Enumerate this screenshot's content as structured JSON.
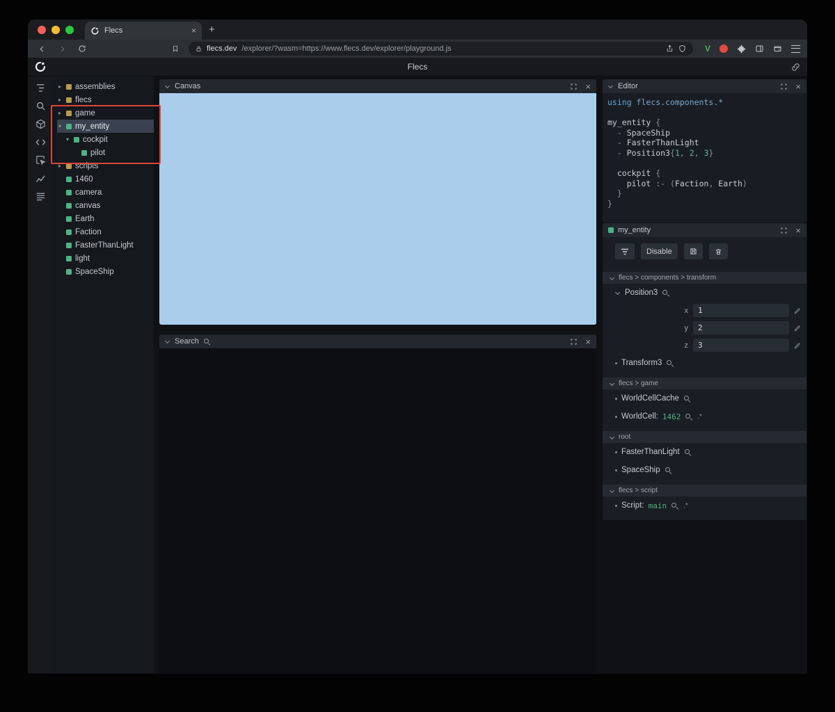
{
  "colors": {
    "accent_green": "#4cb382",
    "module_yellow": "#b99b4e",
    "canvas_blue": "#a9cdea",
    "annotation_red": "#dc453c",
    "selection_highlight": "#3a4150"
  },
  "chrome": {
    "tab_title": "Flecs",
    "url_host": "flecs.dev",
    "url_path": "/explorer/?wasm=https://www.flecs.dev/explorer/playground.js"
  },
  "header": {
    "title": "Flecs"
  },
  "icons": [
    "back-icon",
    "forward-icon",
    "reload-icon",
    "bookmark-icon",
    "lock-icon",
    "share-icon",
    "shield-icon",
    "vue-extension-icon",
    "red-extension-icon",
    "puzzle-icon",
    "sidebar-toggle-icon",
    "wallet-icon",
    "menu-icon",
    "link-icon",
    "fullscreen-icon",
    "close-icon",
    "search-icon",
    "edit-icon",
    "chevron-down-icon",
    "flecs-logo"
  ],
  "rail": {
    "items": [
      {
        "icon": "tree"
      },
      {
        "icon": "search"
      },
      {
        "icon": "cube"
      },
      {
        "icon": "code"
      },
      {
        "icon": "inspect"
      },
      {
        "icon": "chart"
      },
      {
        "icon": "rows"
      }
    ]
  },
  "tree": {
    "items": [
      {
        "label": "assemblies",
        "color": "yellow",
        "depth": 0,
        "expand": "closed",
        "selected": false
      },
      {
        "label": "flecs",
        "color": "yellow",
        "depth": 0,
        "expand": "closed",
        "selected": false
      },
      {
        "label": "game",
        "color": "yellow",
        "depth": 0,
        "expand": "closed",
        "selected": false
      },
      {
        "label": "my_entity",
        "color": "green",
        "depth": 0,
        "expand": "open",
        "selected": true
      },
      {
        "label": "cockpit",
        "color": "green",
        "depth": 1,
        "expand": "open",
        "selected": false
      },
      {
        "label": "pilot",
        "color": "green",
        "depth": 2,
        "expand": "none",
        "selected": false
      },
      {
        "label": "scripts",
        "color": "yellow",
        "depth": 0,
        "expand": "closed",
        "selected": false
      },
      {
        "label": "1460",
        "color": "green",
        "depth": 0,
        "expand": "none",
        "selected": false
      },
      {
        "label": "camera",
        "color": "green",
        "depth": 0,
        "expand": "none",
        "selected": false
      },
      {
        "label": "canvas",
        "color": "green",
        "depth": 0,
        "expand": "none",
        "selected": false
      },
      {
        "label": "Earth",
        "color": "green",
        "depth": 0,
        "expand": "none",
        "selected": false
      },
      {
        "label": "Faction",
        "color": "green",
        "depth": 0,
        "expand": "none",
        "selected": false
      },
      {
        "label": "FasterThanLight",
        "color": "green",
        "depth": 0,
        "expand": "none",
        "selected": false
      },
      {
        "label": "light",
        "color": "green",
        "depth": 0,
        "expand": "none",
        "selected": false
      },
      {
        "label": "SpaceShip",
        "color": "green",
        "depth": 0,
        "expand": "none",
        "selected": false
      }
    ]
  },
  "panels": {
    "canvas": {
      "title": "Canvas"
    },
    "search": {
      "title": "Search"
    },
    "editor": {
      "title": "Editor"
    }
  },
  "editor": {
    "code": [
      [
        {
          "t": "using ",
          "c": "kw"
        },
        {
          "t": "flecs.components.*",
          "c": "kw2"
        }
      ],
      [],
      [
        {
          "t": "my_entity ",
          "c": "df"
        },
        {
          "t": "{",
          "c": "dim"
        }
      ],
      [
        {
          "t": "  ",
          "c": "df"
        },
        {
          "t": "- ",
          "c": "dim"
        },
        {
          "t": "SpaceShip",
          "c": "df"
        }
      ],
      [
        {
          "t": "  ",
          "c": "df"
        },
        {
          "t": "- ",
          "c": "dim"
        },
        {
          "t": "FasterThanLight",
          "c": "df"
        }
      ],
      [
        {
          "t": "  ",
          "c": "df"
        },
        {
          "t": "- ",
          "c": "dim"
        },
        {
          "t": "Position3",
          "c": "df"
        },
        {
          "t": "{",
          "c": "dim"
        },
        {
          "t": "1",
          "c": "num"
        },
        {
          "t": ", ",
          "c": "dim"
        },
        {
          "t": "2",
          "c": "num"
        },
        {
          "t": ", ",
          "c": "dim"
        },
        {
          "t": "3",
          "c": "num"
        },
        {
          "t": "}",
          "c": "dim"
        }
      ],
      [],
      [
        {
          "t": "  cockpit ",
          "c": "df"
        },
        {
          "t": "{",
          "c": "dim"
        }
      ],
      [
        {
          "t": "    pilot ",
          "c": "df"
        },
        {
          "t": ":- ",
          "c": "dim"
        },
        {
          "t": "(",
          "c": "dim"
        },
        {
          "t": "Faction",
          "c": "df"
        },
        {
          "t": ", ",
          "c": "dim"
        },
        {
          "t": "Earth",
          "c": "df"
        },
        {
          "t": ")",
          "c": "dim"
        }
      ],
      [
        {
          "t": "  }",
          "c": "dim"
        }
      ],
      [
        {
          "t": "}",
          "c": "dim"
        }
      ]
    ]
  },
  "inspector": {
    "title": "my_entity",
    "toolbar": {
      "disable_label": "Disable"
    },
    "sections": [
      {
        "label": "flecs > components > transform",
        "rows": [
          {
            "name": "Position3",
            "expanded": true,
            "fields": [
              {
                "label": "x",
                "value": "1"
              },
              {
                "label": "y",
                "value": "2"
              },
              {
                "label": "z",
                "value": "3"
              }
            ]
          },
          {
            "name": "Transform3"
          }
        ]
      },
      {
        "label": "flecs > game",
        "rows": [
          {
            "name": "WorldCellCache"
          },
          {
            "name": "WorldCell:",
            "value": "1462",
            "suffix": ".*"
          }
        ]
      },
      {
        "label": "root",
        "rows": [
          {
            "name": "FasterThanLight"
          },
          {
            "name": "SpaceShip"
          }
        ]
      },
      {
        "label": "flecs > script",
        "rows": [
          {
            "name": "Script:",
            "value": "main",
            "suffix": ".*"
          }
        ]
      }
    ]
  }
}
